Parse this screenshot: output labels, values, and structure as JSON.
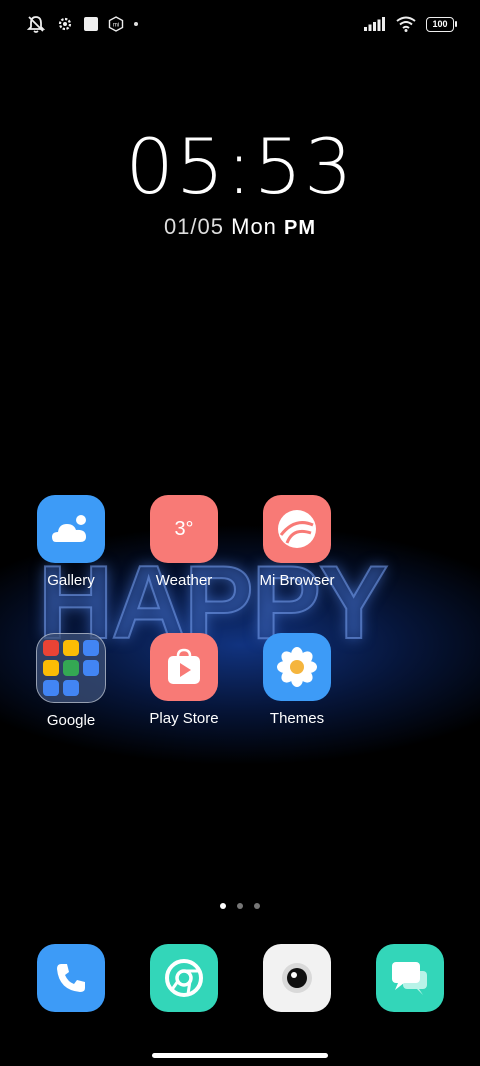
{
  "status_bar": {
    "battery_level": "100",
    "icons": [
      "mute-icon",
      "settings-gear-icon",
      "square-notification-icon",
      "mi-icon",
      "dot-icon",
      "signal-icon",
      "wifi-icon",
      "battery-icon"
    ]
  },
  "lockscreen_clock": {
    "time": "05:53",
    "date": "01/05",
    "weekday": "Mon",
    "period": "PM"
  },
  "wallpaper": {
    "text": "HAPPY"
  },
  "apps": [
    {
      "label": "Gallery",
      "color": "#3d9bf7"
    },
    {
      "label": "Weather",
      "color": "#f87a76",
      "value": "3°"
    },
    {
      "label": "Mi Browser",
      "color": "#f87a76"
    },
    {
      "label": "Google",
      "color": "#2a3a60"
    },
    {
      "label": "Play Store",
      "color": "#f87a76"
    },
    {
      "label": "Themes",
      "color": "#3d9bf7"
    }
  ],
  "pager": {
    "pages": 3,
    "current": 1
  },
  "dock": [
    {
      "name": "Phone",
      "color": "#3d9bf7"
    },
    {
      "name": "Chrome",
      "color": "#33d6b9"
    },
    {
      "name": "Camera",
      "color": "#f2f2f2"
    },
    {
      "name": "Messaging",
      "color": "#33d6b9"
    }
  ]
}
